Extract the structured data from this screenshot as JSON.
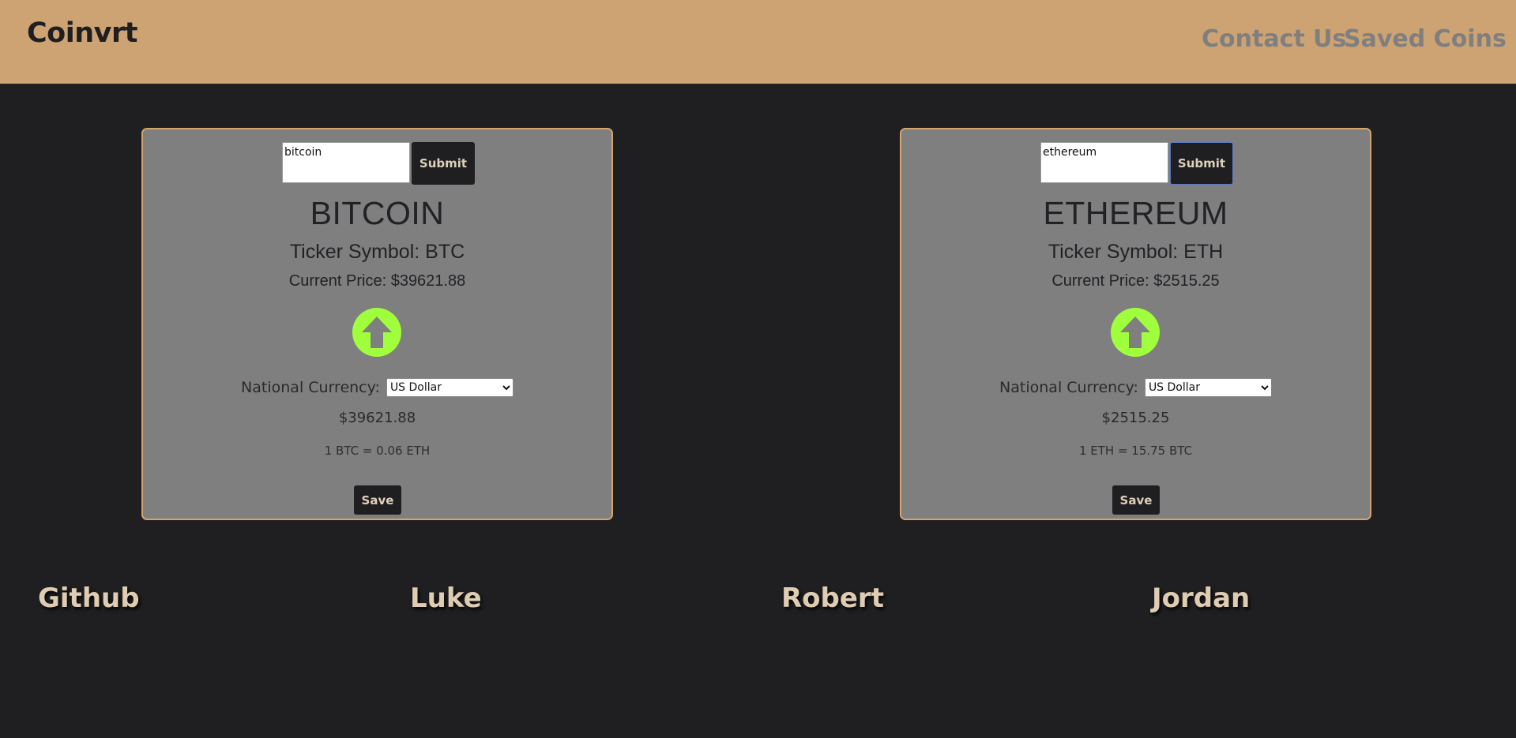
{
  "header": {
    "brand": "Coinvrt",
    "nav": {
      "contact": "Contact Us",
      "saved": "Saved Coins"
    }
  },
  "cards": [
    {
      "search_value": "bitcoin",
      "submit_label": "Submit",
      "coin_name": "BITCOIN",
      "ticker": "Ticker Symbol: BTC",
      "price": "Current Price: $39621.88",
      "trend": "up-arrow-icon",
      "trend_color": "#a0ff3c",
      "currency_label": "National Currency:",
      "currency_selected": "US Dollar",
      "converted": "$39621.88",
      "rate": "1 BTC = 0.06 ETH",
      "save_label": "Save"
    },
    {
      "search_value": "ethereum",
      "submit_label": "Submit",
      "coin_name": "ETHEREUM",
      "ticker": "Ticker Symbol: ETH",
      "price": "Current Price: $2515.25",
      "trend": "up-arrow-icon",
      "trend_color": "#a0ff3c",
      "currency_label": "National Currency:",
      "currency_selected": "US Dollar",
      "converted": "$2515.25",
      "rate": "1 ETH = 15.75 BTC",
      "save_label": "Save"
    }
  ],
  "footer": {
    "github": "Github",
    "luke": "Luke",
    "robert": "Robert",
    "jordan": "Jordan"
  },
  "colors": {
    "header_bg": "#cda373",
    "page_bg": "#1f1e20",
    "card_bg": "#7f7f7f",
    "card_border": "#d2a46e",
    "accent_text": "#dfcdb3"
  }
}
